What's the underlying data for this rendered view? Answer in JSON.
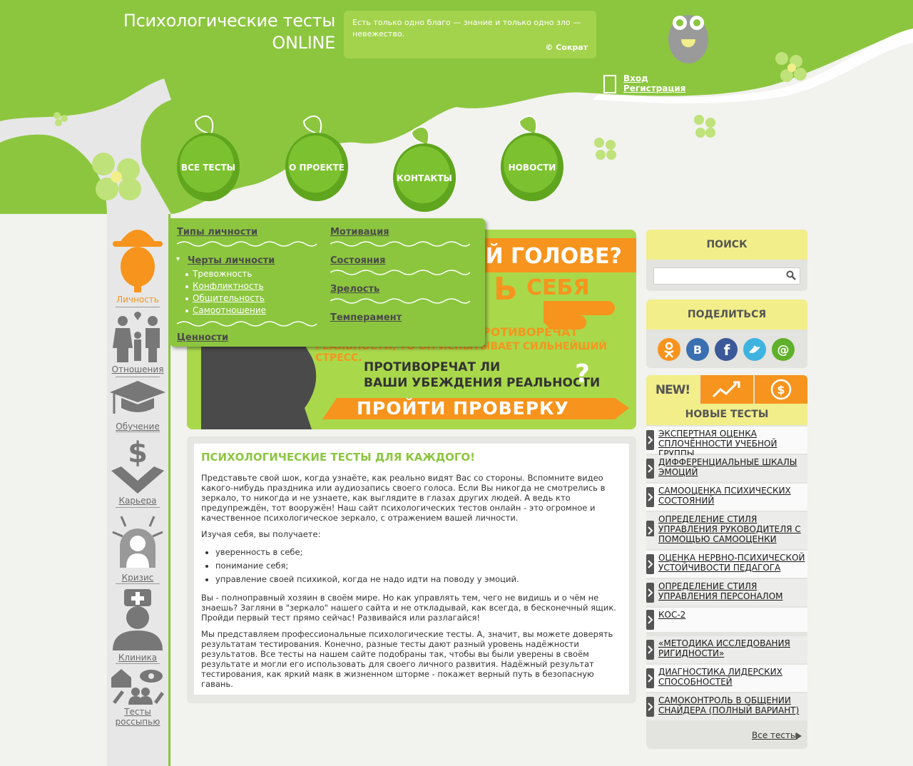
{
  "header": {
    "title_line1": "Психологические тесты",
    "title_line2": "ONLINE",
    "quote_text": "Есть только одно благо — знание и только одно зло — невежество.",
    "quote_author": "© Сократ",
    "login": "Вход",
    "register": "Регистрация"
  },
  "nav": {
    "all_tests": "ВСЕ ТЕСТЫ",
    "about": "О ПРОЕКТЕ",
    "contacts": "КОНТАКТЫ",
    "news": "НОВОСТИ"
  },
  "sidebar": {
    "items": [
      {
        "label": "Личность"
      },
      {
        "label": "Отношения"
      },
      {
        "label": "Обучение"
      },
      {
        "label": "Карьера"
      },
      {
        "label": "Кризис"
      },
      {
        "label": "Клиника"
      },
      {
        "label_line1": "Тесты",
        "label_line2": "россыпью"
      }
    ]
  },
  "dropdown": {
    "left": {
      "types": "Типы личности",
      "traits": "Черты личности",
      "subs": [
        "Тревожность",
        "Конфликтность",
        "Общительность",
        "Самоотношение"
      ],
      "values": "Ценности"
    },
    "right": {
      "motivation": "Мотивация",
      "states": "Состояния",
      "maturity": "Зрелость",
      "temperament": "Темперамент"
    }
  },
  "banner": {
    "top_text": "ЕЙ ГОЛОВЕ?",
    "check_prefix": "Ь",
    "check_self": "СЕБЯ",
    "orange_line1": "РОТИВОРЕЧАТ",
    "orange_line2": "РЕАЛЬНОСТИ, ТО ОН ИСПЫТЫВАЕТ СИЛЬНЕЙШИЙ СТРЕСС.",
    "question_line1": "ПРОТИВОРЕЧАТ ЛИ",
    "question_line2": "ВАШИ УБЕЖДЕНИЯ РЕАЛЬНОСТИ",
    "question_mark": "?",
    "cta": "ПРОЙТИ ПРОВЕРКУ"
  },
  "content": {
    "heading": "ПСИХОЛОГИЧЕСКИЕ ТЕСТЫ ДЛЯ КАЖДОГО!",
    "p1": "Представьте свой шок, когда узнаёте, как реально видят Вас со стороны. Вспомните видео какого-нибудь праздника или аудиозапись своего голоса. Если Вы никогда не смотрелись в зеркало, то никогда и не узнаете, как выглядите в глазах других людей. А ведь кто предупреждён, тот вооружён! Наш сайт психологических тестов онлайн - это огромное и качественное психологическое зеркало, с отражением вашей личности.",
    "p2": "Изучая себя, вы получаете:",
    "bullets": [
      "уверенность в себе;",
      "понимание себя;",
      "управление своей психикой, когда не надо идти на поводу у эмоций."
    ],
    "p3": "Вы - полноправный хозяин в своём мире. Но как управлять тем, чего не видишь и о чём не знаешь? Загляни в \"зеркало\" нашего сайта и не откладывай, как всегда, в бесконечный ящик. Пройди первый тест прямо сейчас! Развивайся или разлагайся!",
    "p4": "Мы представляем профессиональные психологические тесты. А, значит, вы можете доверять результатам тестирования. Конечно, разные тесты дают разный уровень надёжности результатов. Все тесты на нашем сайте подобраны так, чтобы вы были уверены в своём результате и могли его использовать для своего личного развития. Надёжный результат тестирования, как яркий маяк в жизненном шторме - покажет верный путь в безопасную гавань."
  },
  "right": {
    "search_title": "ПОИСК",
    "search_value": "",
    "share_title": "ПОДЕЛИТЬСЯ",
    "tab_new": "NEW!",
    "new_tests_title": "НОВЫЕ ТЕСТЫ",
    "tests": [
      {
        "l1": "ЭКСПЕРТНАЯ ОЦЕНКА",
        "l2": "СПЛОЧЁННОСТИ УЧЕБНОЙ ГРУППЫ",
        "l3": ""
      },
      {
        "l1": "ДИФФЕРЕНЦИАЛЬНЫЕ ШКАЛЫ",
        "l2": "ЭМОЦИЙ",
        "l3": ""
      },
      {
        "l1": "САМООЦЕНКА ПСИХИЧЕСКИХ",
        "l2": "СОСТОЯНИЙ",
        "l3": ""
      },
      {
        "l1": "ОПРЕДЕЛЕНИЕ СТИЛЯ",
        "l2": "УПРАВЛЕНИЯ РУКОВОДИТЕЛЯ С",
        "l3": "ПОМОЩЬЮ САМООЦЕНКИ"
      },
      {
        "l1": "ОЦЕНКА НЕРВНО-ПСИХИЧЕСКОЙ",
        "l2": "УСТОЙЧИВОСТИ ПЕДАГОГА",
        "l3": ""
      },
      {
        "l1": "ОПРЕДЕЛЕНИЕ СТИЛЯ",
        "l2": "УПРАВЛЕНИЯ ПЕРСОНАЛОМ",
        "l3": ""
      },
      {
        "l1": "КОС-2",
        "l2": "",
        "l3": ""
      },
      {
        "l1": "«МЕТОДИКА ИССЛЕДОВАНИЯ",
        "l2": "РИГИДНОСТИ»",
        "l3": ""
      },
      {
        "l1": "ДИАГНОСТИКА ЛИДЕРСКИХ",
        "l2": "СПОСОБНОСТЕЙ",
        "l3": ""
      },
      {
        "l1": "САМОКОНТРОЛЬ В ОБЩЕНИИ",
        "l2": "СНАЙДЕРА (ПОЛНЫЙ ВАРИАНТ)",
        "l3": ""
      }
    ],
    "all_tests": "Все тесты"
  },
  "colors": {
    "green": "#8cc63f",
    "light_green": "#a3d34c",
    "orange": "#f7941d",
    "yellow": "#f2ee8a"
  }
}
